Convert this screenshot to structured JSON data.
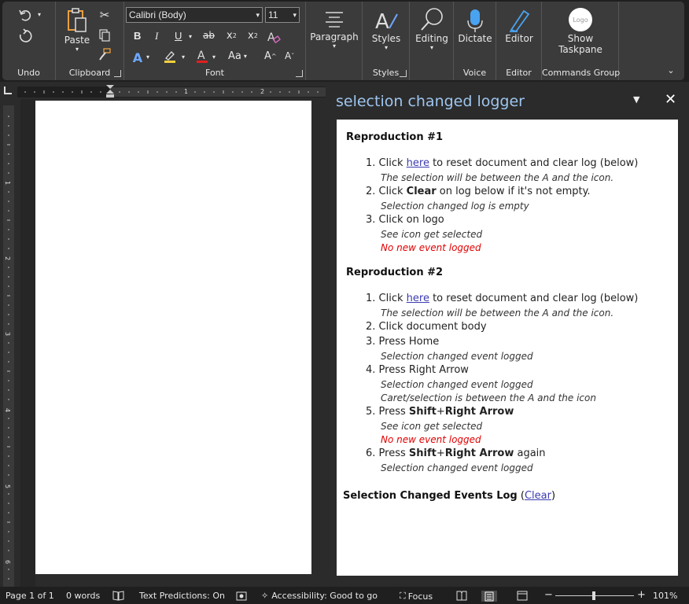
{
  "ribbon": {
    "undo_label": "Undo",
    "clipboard_label": "Clipboard",
    "paste_label": "Paste",
    "font_label": "Font",
    "font_name": "Calibri (Body)",
    "font_size": "11",
    "bold": "B",
    "italic": "I",
    "underline": "U",
    "strike": "ab",
    "subscript": "x",
    "superscript": "x",
    "change_case": "Aa",
    "grow_font": "A",
    "shrink_font": "A",
    "paragraph_label": "Paragraph",
    "styles_label": "Styles",
    "styles_group": "Styles",
    "editing_label": "Editing",
    "dictate_label": "Dictate",
    "voice_group": "Voice",
    "editor_label": "Editor",
    "editor_group": "Editor",
    "show_taskpane_line1": "Show",
    "show_taskpane_line2": "Taskpane",
    "logo_text": "Logo",
    "commands_group": "Commands Group"
  },
  "ruler": {
    "h_numbers": [
      "1",
      "2"
    ],
    "v_numbers": [
      "1",
      "2",
      "3",
      "4",
      "5",
      "6"
    ]
  },
  "taskpane": {
    "title": "selection changed logger",
    "repro1": {
      "heading": "Reproduction #1",
      "s1_num": "1.",
      "s1_pre": "Click ",
      "s1_link": "here",
      "s1_post": " to reset document and clear log (below)",
      "n1": "The selection will be between the A and the icon.",
      "s2_num": "2.",
      "s2_pre": "Click ",
      "s2_bold": "Clear",
      "s2_post": " on log below if it's not empty.",
      "n2": "Selection changed log is empty",
      "s3_num": "3.",
      "s3": "Click on logo",
      "n3a": "See icon get selected",
      "n3b": "No new event logged"
    },
    "repro2": {
      "heading": "Reproduction #2",
      "s1_num": "1.",
      "s1_pre": "Click ",
      "s1_link": "here",
      "s1_post": " to reset document and clear log (below)",
      "n1": "The selection will be between the A and the icon.",
      "s2_num": "2.",
      "s2": "Click document body",
      "s3_num": "3.",
      "s3": "Press Home",
      "n3": "Selection changed event logged",
      "s4_num": "4.",
      "s4": "Press Right Arrow",
      "n4a": "Selection changed event logged",
      "n4b": "Caret/selection is between the A and the icon",
      "s5_num": "5.",
      "s5_pre": "Press ",
      "s5_b1": "Shift",
      "s5_plus": "+",
      "s5_b2": "Right Arrow",
      "n5a": "See icon get selected",
      "n5b": "No new event logged",
      "s6_num": "6.",
      "s6_pre": "Press ",
      "s6_b1": "Shift",
      "s6_plus": "+",
      "s6_b2": "Right Arrow",
      "s6_post": " again",
      "n6": "Selection changed event logged"
    },
    "log": {
      "title": "Selection Changed Events Log",
      "open_paren": " (",
      "clear_link": "Clear",
      "close_paren": ")"
    }
  },
  "status": {
    "page": "Page 1 of 1",
    "words": "0 words",
    "predictions": "Text Predictions: On",
    "accessibility": "Accessibility: Good to go",
    "focus": "Focus",
    "zoom_minus": "−",
    "zoom_plus": "+",
    "zoom": "101%"
  },
  "colors": {
    "accent_title": "#9ec6ef",
    "link": "#3b3bb0",
    "warning": "#e00000"
  }
}
